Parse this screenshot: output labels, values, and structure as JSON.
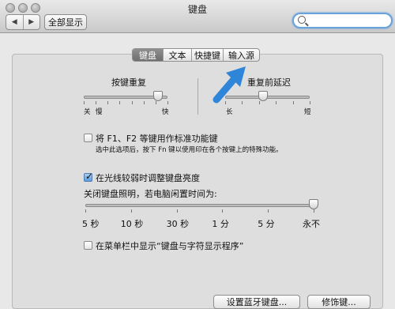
{
  "window": {
    "title": "键盘"
  },
  "toolbar": {
    "back_glyph": "◀",
    "forward_glyph": "▶",
    "show_all_label": "全部显示",
    "search_value": ""
  },
  "tabs": [
    {
      "label": "键盘",
      "active": true
    },
    {
      "label": "文本",
      "active": false
    },
    {
      "label": "快捷键",
      "active": false
    },
    {
      "label": "输入源",
      "active": false
    }
  ],
  "key_repeat": {
    "title": "按键重复",
    "left_label": "关",
    "mid_label": "慢",
    "right_label": "快",
    "level": 0.89
  },
  "delay_until_repeat": {
    "title": "重复前延迟",
    "left_label": "长",
    "right_label": "短",
    "level": 0.45
  },
  "function_keys": {
    "checked": false,
    "label": "将 F1、F2 等键用作标准功能键",
    "description": "选中此选项后，按下 Fn 键以使用印在各个按键上的特殊功能。"
  },
  "auto_brightness": {
    "checked": true,
    "label": "在光线较弱时调整键盘亮度"
  },
  "backlight_off": {
    "title": "关闭键盘照明，若电脑闲置时间为:",
    "ticks": [
      "5 秒",
      "10 秒",
      "30 秒",
      "1 分",
      "5 分",
      "永不"
    ],
    "level": 1.0
  },
  "menu_bar": {
    "checked": false,
    "label": "在菜单栏中显示“键盘与字符显示程序”"
  },
  "buttons": {
    "bluetooth": "设置蓝牙键盘...",
    "modifier": "修饰键..."
  },
  "colors": {
    "accent": "#2f7fd6",
    "arrow": "#2f86d9"
  },
  "icons": {
    "search": "search-icon",
    "annotation_arrow": "arrow-icon"
  }
}
